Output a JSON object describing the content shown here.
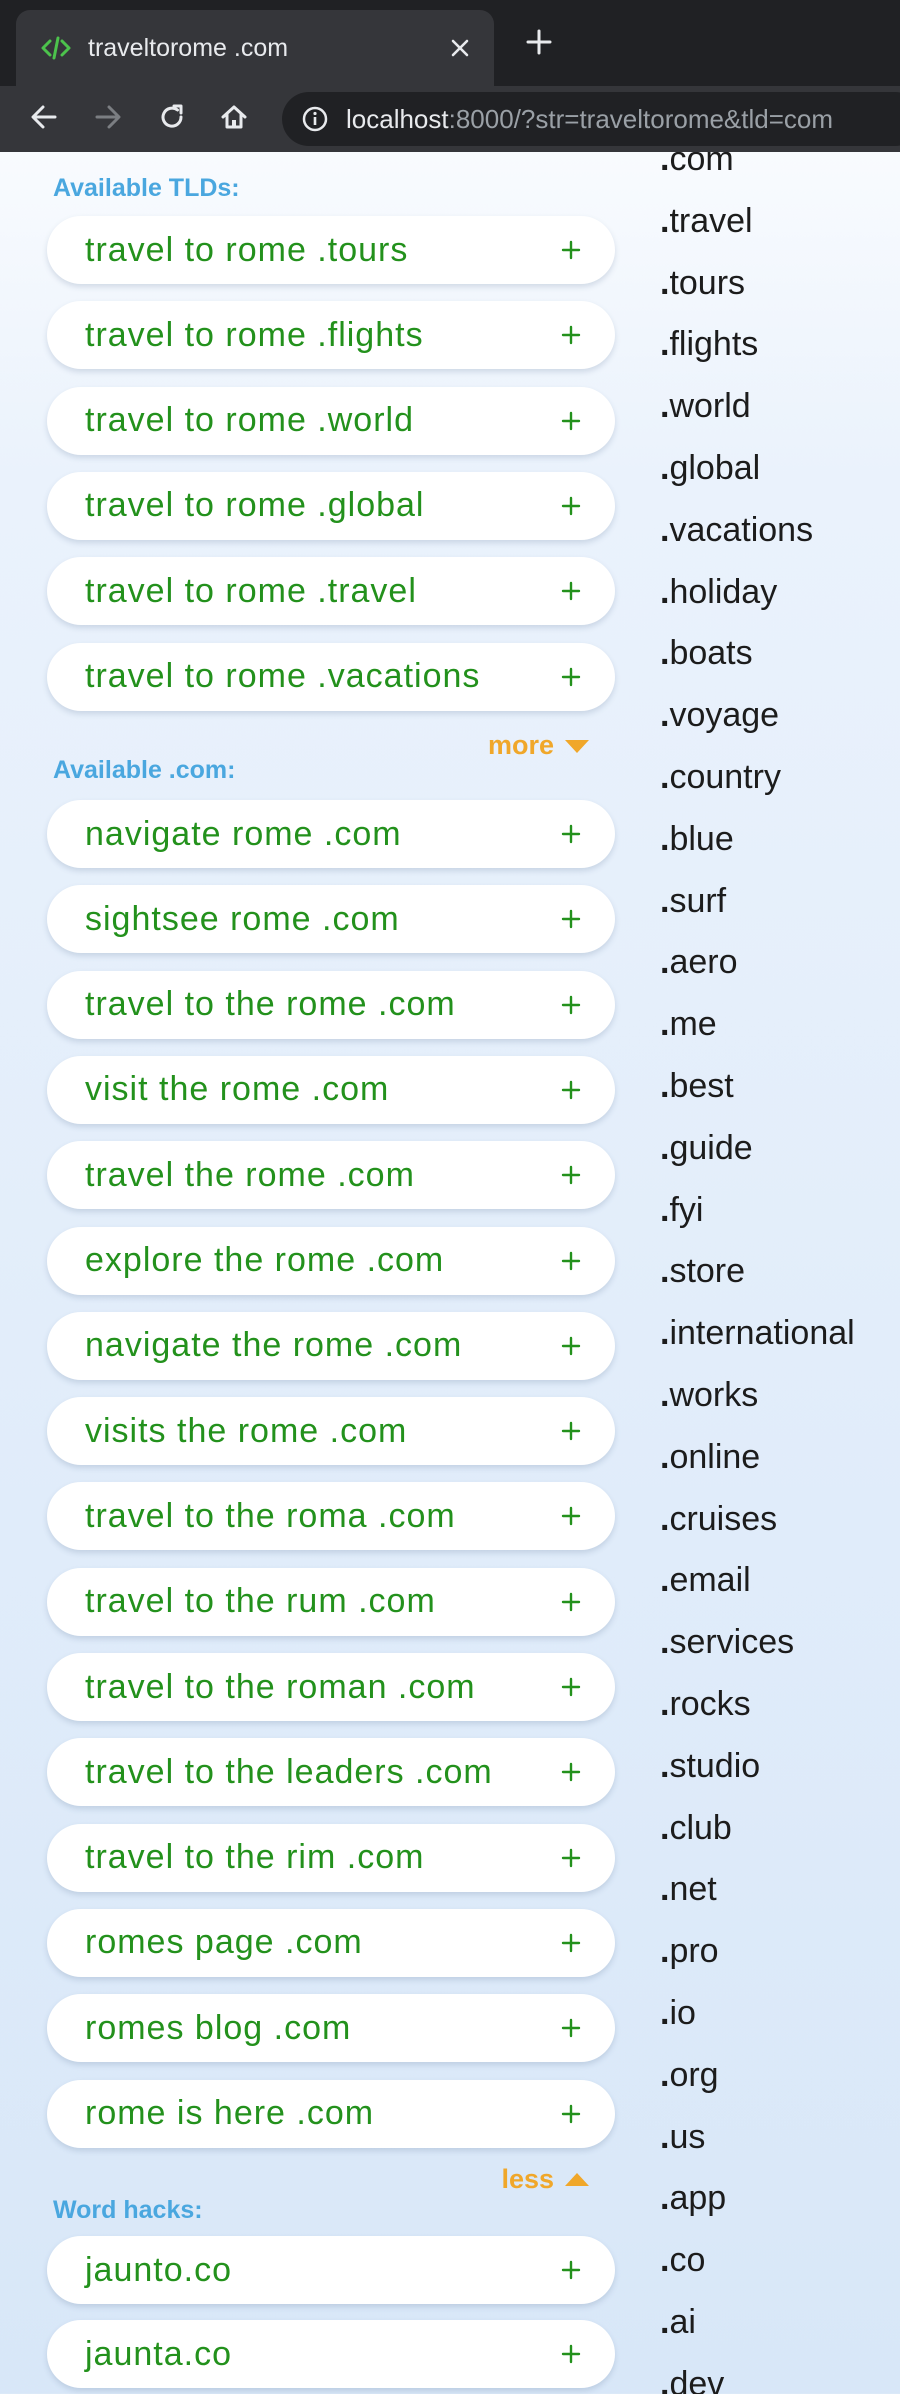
{
  "browser": {
    "tab_title": "traveltorome .com",
    "url_host": "localhost",
    "url_rest": ":8000/?str=traveltorome&tld=com"
  },
  "sections": {
    "tlds_title": "Available TLDs:",
    "com_title": "Available .com:",
    "hacks_title": "Word hacks:",
    "more_label": "more",
    "less_label": "less"
  },
  "tld_domains": [
    "travel to rome .tours",
    "travel to rome .flights",
    "travel to rome .world",
    "travel to rome .global",
    "travel to rome .travel",
    "travel to rome .vacations"
  ],
  "com_domains": [
    "navigate rome .com",
    "sightsee rome .com",
    "travel to the rome .com",
    "visit the rome .com",
    "travel the rome .com",
    "explore the rome .com",
    "navigate the rome .com",
    "visits the rome .com",
    "travel to the roma .com",
    "travel to the rum .com",
    "travel to the roman .com",
    "travel to the leaders .com",
    "travel to the rim .com",
    "romes page .com",
    "romes blog .com",
    "rome is here .com"
  ],
  "hack_domains": [
    "jaunto.co",
    "jaunta.co"
  ],
  "tld_list": [
    "com",
    "travel",
    "tours",
    "flights",
    "world",
    "global",
    "vacations",
    "holiday",
    "boats",
    "voyage",
    "country",
    "blue",
    "surf",
    "aero",
    "me",
    "best",
    "guide",
    "fyi",
    "store",
    "international",
    "works",
    "online",
    "cruises",
    "email",
    "services",
    "rocks",
    "studio",
    "club",
    "net",
    "pro",
    "io",
    "org",
    "us",
    "app",
    "co",
    "ai",
    "dev"
  ],
  "colors": {
    "section_title": "#4aa7df",
    "domain_text": "#23911c",
    "toggle": "#f0a72a"
  }
}
